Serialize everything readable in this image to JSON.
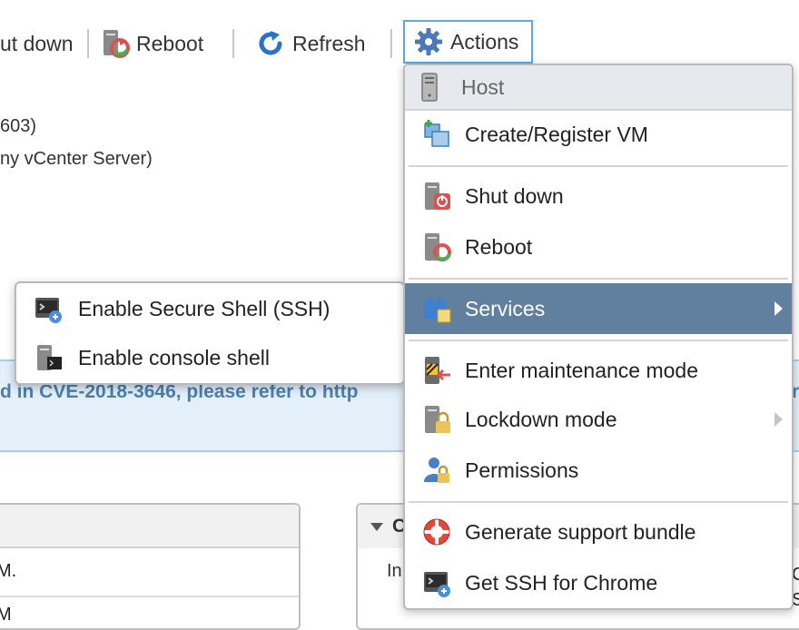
{
  "toolbar": {
    "shutdown_label": "ut down",
    "reboot_label": "Reboot",
    "refresh_label": "Refresh",
    "actions_label": "Actions"
  },
  "background": {
    "line1": "603)",
    "line2": "ny vCenter Server)",
    "banner_text": "d in CVE-2018-3646, please refer to http",
    "banner_text_right": "r",
    "right_panel_title": "C",
    "right_panel_row": "In",
    "left_panel_row1": "M.",
    "left_panel_row2": "M",
    "right_edge_row1": "C",
    "right_edge_row2": "S"
  },
  "actions_menu": {
    "header": "Host",
    "items": [
      {
        "label": "Create/Register VM",
        "icon": "create-vm-icon"
      },
      {
        "label": "Shut down",
        "icon": "shutdown-icon"
      },
      {
        "label": "Reboot",
        "icon": "reboot-icon"
      },
      {
        "label": "Services",
        "icon": "services-icon",
        "submenu": true,
        "active": true
      },
      {
        "label": "Enter maintenance mode",
        "icon": "maintenance-icon"
      },
      {
        "label": "Lockdown mode",
        "icon": "lockdown-icon",
        "submenu": true
      },
      {
        "label": "Permissions",
        "icon": "permissions-icon"
      },
      {
        "label": "Generate support bundle",
        "icon": "lifebuoy-icon"
      },
      {
        "label": "Get SSH for Chrome",
        "icon": "ssh-chrome-icon"
      }
    ]
  },
  "services_submenu": {
    "items": [
      {
        "label": "Enable Secure Shell (SSH)",
        "icon": "ssh-icon"
      },
      {
        "label": "Enable console shell",
        "icon": "console-shell-icon"
      }
    ]
  },
  "colors": {
    "accent": "#5aa9e6",
    "menu_active_bg": "#617f9e",
    "banner_bg": "#e3eff9",
    "banner_text": "#4a7fb0"
  }
}
